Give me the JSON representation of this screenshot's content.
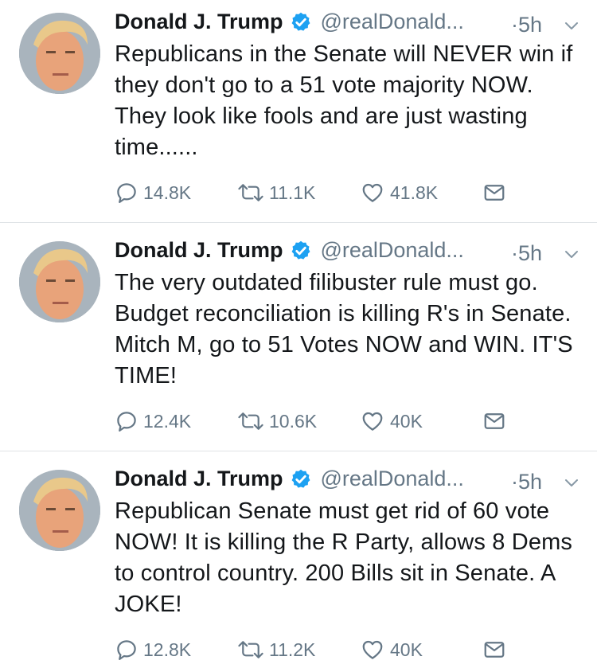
{
  "tweets": [
    {
      "name": "Donald J. Trump",
      "handle": "@realDonald...",
      "time": "·5h",
      "text": "Republicans in the Senate will NEVER win if they don't go to a 51 vote majority NOW. They look like fools and are just wasting time......",
      "replies": "14.8K",
      "retweets": "11.1K",
      "likes": "41.8K"
    },
    {
      "name": "Donald J. Trump",
      "handle": "@realDonald...",
      "time": "·5h",
      "text": "The very outdated filibuster rule must go. Budget reconciliation is killing R's in Senate. Mitch M, go to 51 Votes NOW and WIN. IT'S TIME!",
      "replies": "12.4K",
      "retweets": "10.6K",
      "likes": "40K"
    },
    {
      "name": "Donald J. Trump",
      "handle": "@realDonald...",
      "time": "·5h",
      "text": "Republican Senate must get rid of 60 vote NOW! It is killing the R Party, allows 8 Dems to control country. 200 Bills sit in Senate. A JOKE!",
      "replies": "12.8K",
      "retweets": "11.2K",
      "likes": "40K"
    }
  ],
  "colors": {
    "verified": "#1da1f2",
    "text": "#14171a",
    "secondary": "#657786",
    "divider": "#dfe3e6"
  },
  "icons": [
    "reply-icon",
    "retweet-icon",
    "like-icon",
    "direct-message-icon",
    "verified-badge-icon",
    "chevron-down-icon"
  ]
}
